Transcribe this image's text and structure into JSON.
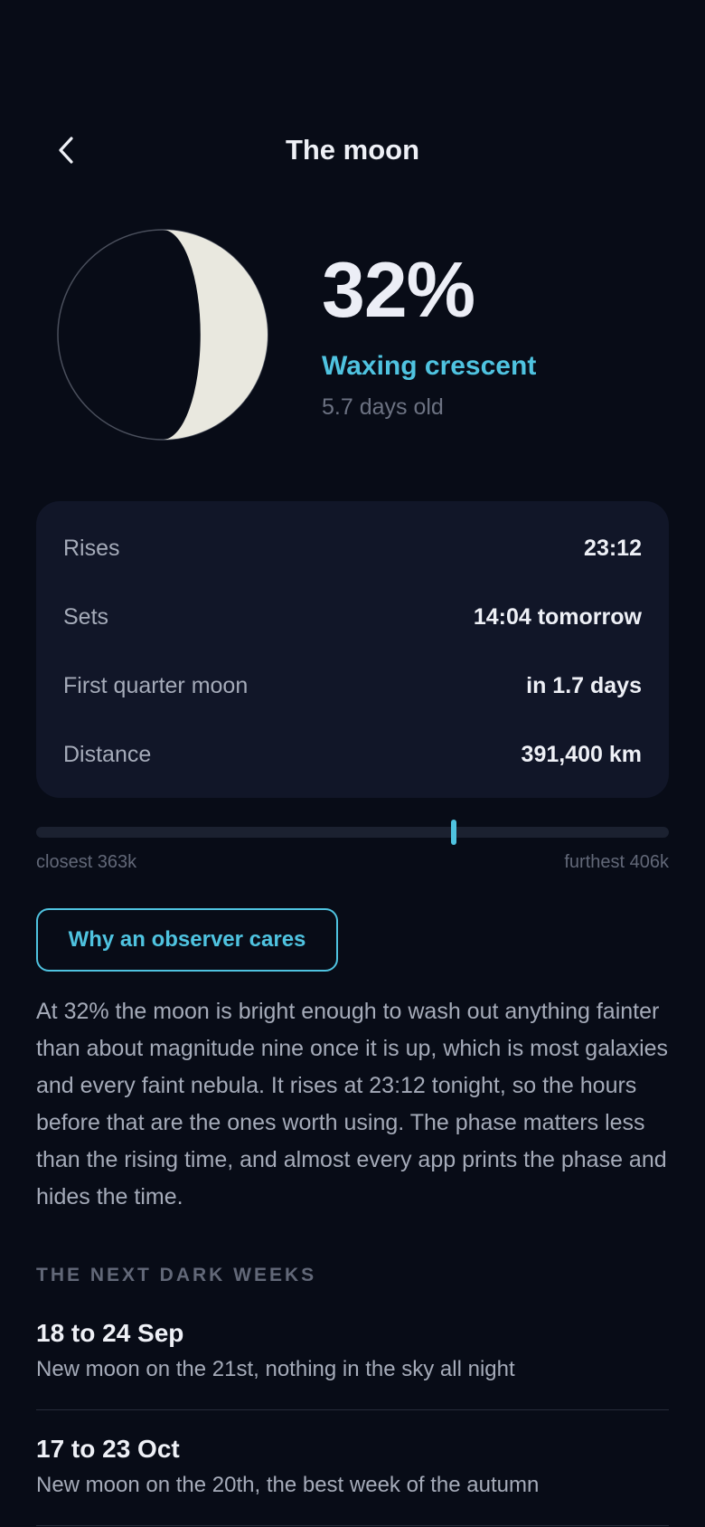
{
  "header": {
    "title": "The moon",
    "back_icon": "chevron-left-icon"
  },
  "moon": {
    "illumination_label": "32%",
    "illumination_fraction": 0.32,
    "phase": "Waxing crescent",
    "age": "5.7 days old"
  },
  "stats": [
    {
      "label": "Rises",
      "value": "23:12"
    },
    {
      "label": "Sets",
      "value": "14:04 tomorrow"
    },
    {
      "label": "First quarter moon",
      "value": "in 1.7 days"
    },
    {
      "label": "Distance",
      "value": "391,400 km"
    }
  ],
  "distance_range": {
    "min_label": "closest 363k",
    "max_label": "furthest 406k",
    "min_km": 363000,
    "max_km": 406000,
    "current_km": 391400
  },
  "observer": {
    "button_label": "Why an observer cares",
    "text": "At 32% the moon is bright enough to wash out anything fainter than about magnitude nine once it is up, which is most galaxies and every faint nebula. It rises at 23:12 tonight, so the hours before that are the ones worth using. The phase matters less than the rising time, and almost every app prints the phase and hides the time."
  },
  "dark_weeks": {
    "heading": "THE NEXT DARK WEEKS",
    "items": [
      {
        "dates": "18 to 24 Sep",
        "desc": "New moon on the 21st, nothing in the sky all night"
      },
      {
        "dates": "17 to 23 Oct",
        "desc": "New moon on the 20th, the best week of the autumn"
      }
    ]
  },
  "colors": {
    "background": "#080c17",
    "card": "#111628",
    "accent": "#4fc3e0",
    "moon_lit": "#e9e8df",
    "moon_dark": "#080c17"
  }
}
